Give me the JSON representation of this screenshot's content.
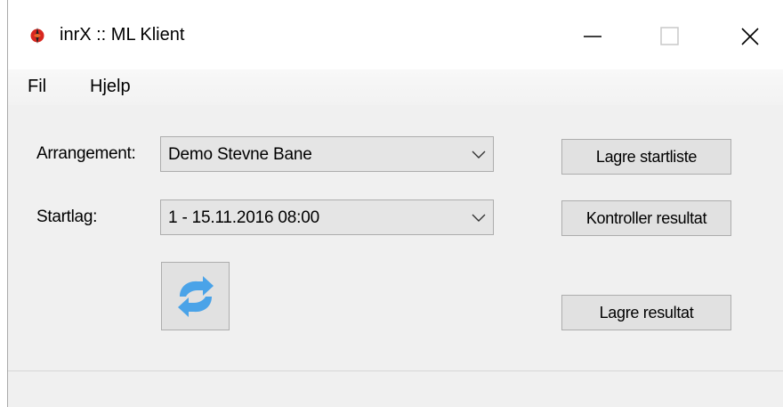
{
  "window": {
    "title": "inrX :: ML Klient",
    "icon": "inrx-app-icon",
    "controls": {
      "minimize": "minimize-icon",
      "maximize": "maximize-icon",
      "close": "close-icon"
    }
  },
  "menubar": {
    "items": [
      {
        "label": "Fil"
      },
      {
        "label": "Hjelp"
      }
    ]
  },
  "form": {
    "arrangement": {
      "label": "Arrangement:",
      "value": "Demo Stevne Bane"
    },
    "startlag": {
      "label": "Startlag:",
      "value": "1 - 15.11.2016 08:00"
    },
    "refresh_icon": "refresh-arrows-icon"
  },
  "actions": {
    "lagre_startliste": "Lagre startliste",
    "kontroller_resultat": "Kontroller resultat",
    "lagre_resultat": "Lagre resultat"
  },
  "colors": {
    "refresh_arrow": "#4aa3e8",
    "app_icon_red": "#d8261f"
  }
}
